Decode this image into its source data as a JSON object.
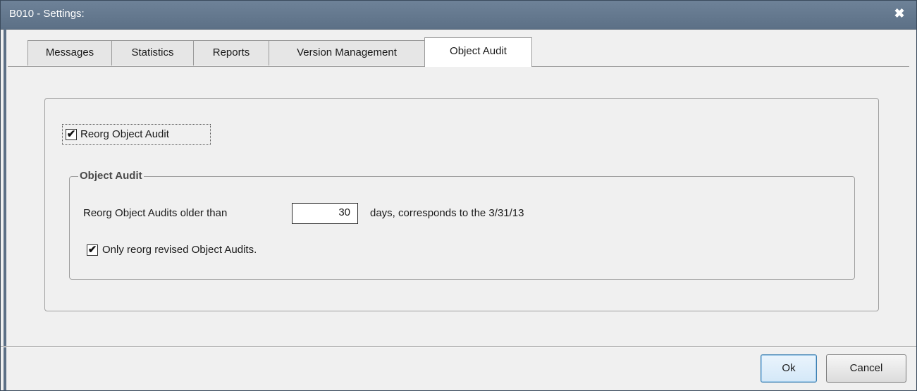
{
  "window": {
    "title": "B010 - Settings:",
    "close_glyph": "✖"
  },
  "tabs": [
    {
      "label": "Messages"
    },
    {
      "label": "Statistics"
    },
    {
      "label": "Reports"
    },
    {
      "label": "Version Management"
    },
    {
      "label": "Object Audit",
      "active": true
    }
  ],
  "reorg": {
    "checkbox_label": "Reorg Object Audit",
    "checked": true,
    "check_glyph": "✔"
  },
  "group": {
    "legend": "Object Audit",
    "older_than_label": "Reorg Object Audits older than",
    "days_value": "30",
    "days_suffix": "days, corresponds to the 3/31/13",
    "only_revised_label": "Only reorg revised Object Audits.",
    "only_revised_checked": true
  },
  "buttons": {
    "ok": "Ok",
    "cancel": "Cancel"
  },
  "colors": {
    "titlebar": "#5c7086",
    "default_button_border": "#3c7fb1"
  }
}
